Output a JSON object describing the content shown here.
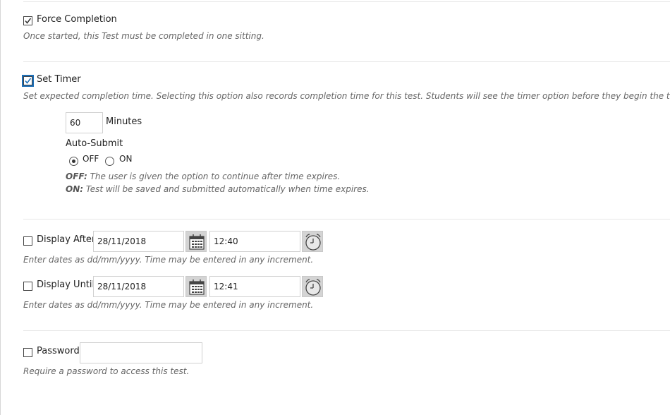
{
  "force_completion": {
    "label": "Force Completion",
    "checked": true,
    "help": "Once started, this Test must be completed in one sitting."
  },
  "set_timer": {
    "label": "Set Timer",
    "checked": true,
    "help": "Set expected completion time. Selecting this option also records completion time for this test. Students will see the timer option before they begin the test.",
    "minutes_value": "60",
    "minutes_label": "Minutes",
    "auto_submit": {
      "label": "Auto-Submit",
      "off_label": "OFF",
      "on_label": "ON",
      "selected": "OFF",
      "off_help_key": "OFF:",
      "off_help_text": " The user is given the option to continue after time expires.",
      "on_help_key": "ON:",
      "on_help_text": " Test will be saved and submitted automatically when time expires."
    }
  },
  "display_after": {
    "label": "Display After",
    "checked": false,
    "date": "28/11/2018",
    "time": "12:40",
    "help": "Enter dates as dd/mm/yyyy. Time may be entered in any increment."
  },
  "display_until": {
    "label": "Display Until",
    "checked": false,
    "date": "28/11/2018",
    "time": "12:41",
    "help": "Enter dates as dd/mm/yyyy. Time may be entered in any increment."
  },
  "password": {
    "label": "Password",
    "checked": false,
    "value": "",
    "help": "Require a password to access this test."
  },
  "icons": {
    "calendar": "calendar-icon",
    "clock": "clock-icon",
    "checkmark": "checkmark-icon"
  }
}
